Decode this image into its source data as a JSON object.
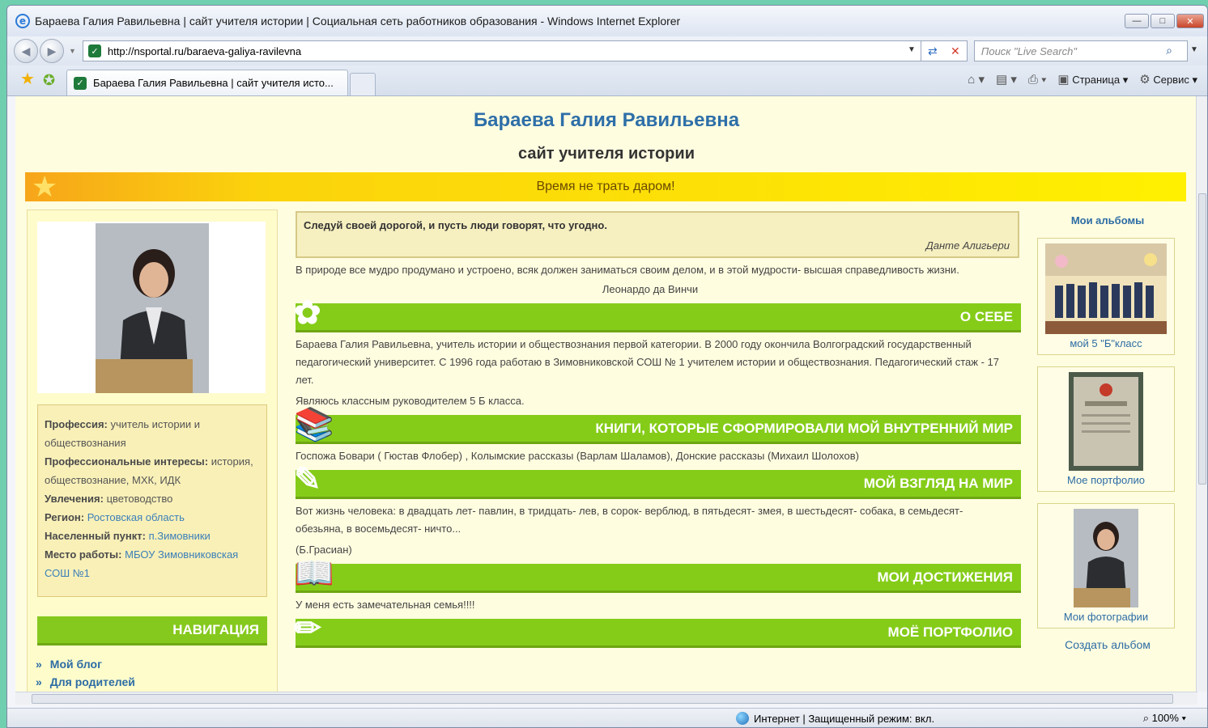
{
  "window": {
    "title": "Бараева Галия Равильевна | сайт учителя истории | Социальная сеть работников образования - Windows Internet Explorer",
    "url": "http://nsportal.ru/baraeva-galiya-ravilevna",
    "search_placeholder": "Поиск \"Live Search\"",
    "tab_label": "Бараева Галия Равильевна | сайт учителя исто...",
    "cmd_page": "Страница",
    "cmd_service": "Сервис",
    "status_zone": "Интернет | Защищенный режим: вкл.",
    "zoom": "100%"
  },
  "site": {
    "name": "Бараева Галия Равильевна",
    "subtitle": "сайт учителя истории",
    "banner": "Время не трать даром!"
  },
  "profile": {
    "profession_label": "Профессия:",
    "profession_value": "учитель истории и обществознания",
    "interests_label": "Профессиональные интересы:",
    "interests_value": "история, обществознание, МХК, ИДК",
    "hobby_label": "Увлечения:",
    "hobby_value": "цветоводство",
    "region_label": "Регион:",
    "region_value": "Ростовская область",
    "town_label": "Населенный пункт:",
    "town_value": "п.Зимовники",
    "work_label": "Место работы:",
    "work_value": "МБОУ Зимовниковская СОШ №1"
  },
  "navigation": {
    "header": "НАВИГАЦИЯ",
    "links": [
      "Мой блог",
      "Для родителей"
    ]
  },
  "main": {
    "quote_text": "Следуй  своей дорогой, и пусть люди говорят, что угодно.",
    "quote_author": "Данте Алигьери",
    "para1": "В природе  все мудро  продумано и устроено, всяк должен заниматься  своим делом, и в этой мудрости- высшая справедливость жизни.",
    "para1_author": "Леонардо да Винчи",
    "sec_about": "О СЕБЕ",
    "about_text": "Бараева Галия Равильевна, учитель истории и обществознания  первой категории. В  2000  году   окончила  Волгоградский государственный педагогический университет. С  1996 года работаю в  Зимовниковской  СОШ № 1   учителем истории и обществознания. Педагогический стаж  - 17 лет.",
    "about_text2": "Являюсь классным руководителем 5 Б класса.",
    "sec_books": "КНИГИ, КОТОРЫЕ СФОРМИРОВАЛИ МОЙ ВНУТРЕННИЙ МИР",
    "books_text": "Госпожа Бовари ( Гюстав Флобер) , Колымские рассказы (Варлам Шаламов), Донские рассказы (Михаил Шолохов)",
    "sec_view": "МОЙ ВЗГЛЯД НА МИР",
    "view_text": "Вот жизнь человека: в двадцать лет- павлин, в тридцать- лев, в сорок- верблюд, в пятьдесят- змея, в шестьдесят- собака, в семьдесят- обезьяна, в восемьдесят- ничто...",
    "view_author": "(Б.Грасиан)",
    "sec_achievements": "МОИ ДОСТИЖЕНИЯ",
    "achievements_text": "У меня есть замечательная  семья!!!!",
    "sec_portfolio": "МОЁ ПОРТФОЛИО"
  },
  "albums": {
    "title": "Мои альбомы",
    "items": [
      "мой 5 \"Б\"класс",
      "Мое портфолио",
      "Мои фотографии"
    ],
    "create": "Создать альбом"
  },
  "colors": {
    "green_bar": "#85cc19",
    "page_bg": "#fffde0",
    "link": "#2c6ca4"
  }
}
